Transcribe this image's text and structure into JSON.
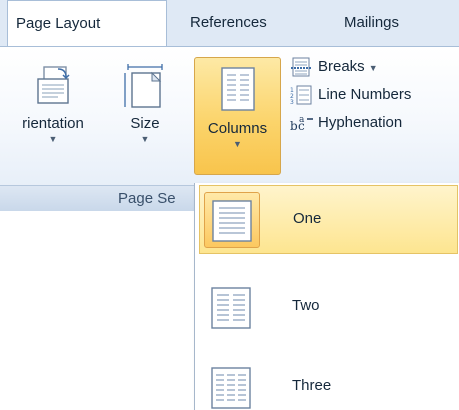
{
  "tabs": [
    {
      "label": "Page Layout",
      "active": true
    },
    {
      "label": "References",
      "active": false
    },
    {
      "label": "Mailings",
      "active": false
    }
  ],
  "ribbon": {
    "group_label": "Page Se",
    "orientation_label": "rientation",
    "size_label": "Size",
    "columns_label": "Columns",
    "breaks_label": "Breaks",
    "line_numbers_label": "Line Numbers",
    "hyphenation_label": "Hyphenation",
    "dropdown_glyph": "▼"
  },
  "columns_menu": {
    "items": [
      {
        "label": "One",
        "selected": true
      },
      {
        "label": "Two",
        "selected": false
      },
      {
        "label": "Three",
        "selected": false
      }
    ]
  },
  "colors": {
    "accent_hover": "#fbd46b",
    "tab_strip": "#dfe9f5",
    "text": "#15283b"
  }
}
